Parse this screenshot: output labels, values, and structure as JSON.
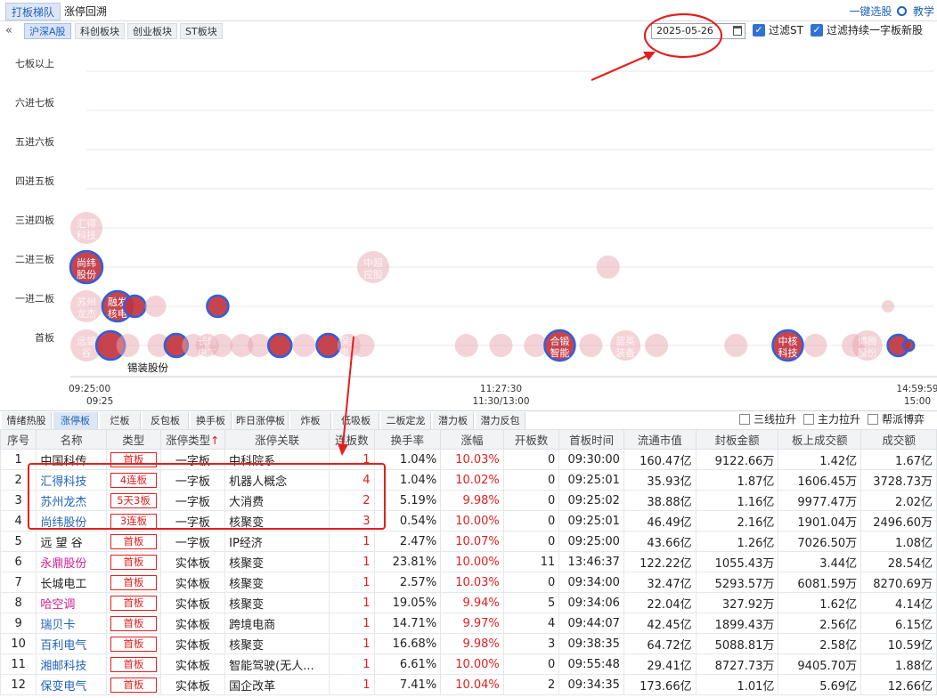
{
  "top_tabs": [
    {
      "label": "打板梯队",
      "active": true
    },
    {
      "label": "涨停回溯",
      "active": false
    }
  ],
  "top_right": {
    "stock_pick": "一键选股",
    "tutorial": "教学"
  },
  "sub_tabs": [
    {
      "label": "沪深A股",
      "active": true
    },
    {
      "label": "科创板块",
      "active": false
    },
    {
      "label": "创业板块",
      "active": false
    },
    {
      "label": "ST板块",
      "active": false
    }
  ],
  "date_value": "2025-05-26",
  "filters": [
    {
      "label": "过滤ST",
      "checked": true
    },
    {
      "label": "过滤持续一字板新股",
      "checked": true
    }
  ],
  "chart_data": {
    "type": "scatter",
    "y_levels": [
      "首板",
      "一进二板",
      "二进三板",
      "三进四板",
      "四进五板",
      "五进六板",
      "六进七板",
      "七板以上"
    ],
    "x_ticks": [
      {
        "time": "09:25:00",
        "sub": "09:25"
      },
      {
        "time": "11:27:30",
        "sub": "11:30/13:00"
      },
      {
        "time": "14:59:59",
        "sub": "15:00"
      }
    ],
    "x_range_minutes": [
      0,
      240
    ],
    "hover_label": "锡装股份",
    "bubbles": [
      {
        "level": 3,
        "t": 0,
        "r": 18,
        "style": "faint",
        "label": "汇得科技"
      },
      {
        "level": 2,
        "t": 0,
        "r": 18,
        "style": "strong",
        "label": "尚纬股份"
      },
      {
        "level": 2,
        "t": 83,
        "r": 18,
        "style": "faint",
        "label": "中超控股"
      },
      {
        "level": 2,
        "t": 151,
        "r": 13,
        "style": "faint",
        "label": ""
      },
      {
        "level": 1,
        "t": 0,
        "r": 18,
        "style": "faint",
        "label": "苏州龙杰"
      },
      {
        "level": 1,
        "t": 9,
        "r": 17,
        "style": "strong",
        "label": "融发核电"
      },
      {
        "level": 1,
        "t": 14,
        "r": 12,
        "style": "strong",
        "label": ""
      },
      {
        "level": 1,
        "t": 20,
        "r": 12,
        "style": "faint",
        "label": ""
      },
      {
        "level": 1,
        "t": 38,
        "r": 12,
        "style": "strong",
        "label": ""
      },
      {
        "level": 1,
        "t": 232,
        "r": 7,
        "style": "faint",
        "label": ""
      },
      {
        "level": 0,
        "t": 0,
        "r": 18,
        "style": "faint",
        "label": "远望谷"
      },
      {
        "level": 0,
        "t": 7,
        "r": 16,
        "style": "strong",
        "label": ""
      },
      {
        "level": 0,
        "t": 12,
        "r": 13,
        "style": "faint",
        "label": ""
      },
      {
        "level": 0,
        "t": 21,
        "r": 13,
        "style": "faint",
        "label": ""
      },
      {
        "level": 0,
        "t": 26,
        "r": 13,
        "style": "strong",
        "label": ""
      },
      {
        "level": 0,
        "t": 31,
        "r": 13,
        "style": "faint",
        "label": ""
      },
      {
        "level": 0,
        "t": 35,
        "r": 13,
        "style": "faint",
        "label": "长城电工"
      },
      {
        "level": 0,
        "t": 39,
        "r": 13,
        "style": "faint",
        "label": ""
      },
      {
        "level": 0,
        "t": 45,
        "r": 13,
        "style": "faint",
        "label": ""
      },
      {
        "level": 0,
        "t": 50,
        "r": 13,
        "style": "faint",
        "label": ""
      },
      {
        "level": 0,
        "t": 56,
        "r": 13,
        "style": "strong",
        "label": ""
      },
      {
        "level": 0,
        "t": 63,
        "r": 13,
        "style": "faint",
        "label": ""
      },
      {
        "level": 0,
        "t": 70,
        "r": 13,
        "style": "strong",
        "label": ""
      },
      {
        "level": 0,
        "t": 76,
        "r": 13,
        "style": "faint",
        "label": "保变电气"
      },
      {
        "level": 0,
        "t": 80,
        "r": 13,
        "style": "faint",
        "label": ""
      },
      {
        "level": 0,
        "t": 110,
        "r": 13,
        "style": "faint",
        "label": ""
      },
      {
        "level": 0,
        "t": 120,
        "r": 13,
        "style": "faint",
        "label": ""
      },
      {
        "level": 0,
        "t": 130,
        "r": 13,
        "style": "faint",
        "label": ""
      },
      {
        "level": 0,
        "t": 137,
        "r": 17,
        "style": "strong",
        "label": "合锻智能"
      },
      {
        "level": 0,
        "t": 146,
        "r": 13,
        "style": "faint",
        "label": ""
      },
      {
        "level": 0,
        "t": 156,
        "r": 17,
        "style": "faint",
        "label": "蓝英装备"
      },
      {
        "level": 0,
        "t": 165,
        "r": 13,
        "style": "faint",
        "label": ""
      },
      {
        "level": 0,
        "t": 188,
        "r": 13,
        "style": "faint",
        "label": ""
      },
      {
        "level": 0,
        "t": 203,
        "r": 17,
        "style": "strong",
        "label": "中核科技"
      },
      {
        "level": 0,
        "t": 211,
        "r": 13,
        "style": "faint",
        "label": ""
      },
      {
        "level": 0,
        "t": 222,
        "r": 13,
        "style": "faint",
        "label": ""
      },
      {
        "level": 0,
        "t": 226,
        "r": 17,
        "style": "faint",
        "label": "博腾股份"
      },
      {
        "level": 0,
        "t": 235,
        "r": 12,
        "style": "strong",
        "label": ""
      },
      {
        "level": 0,
        "t": 238,
        "r": 6,
        "style": "strong",
        "label": ""
      }
    ]
  },
  "bottom_tabs": [
    {
      "label": "情绪热股",
      "active": false
    },
    {
      "label": "涨停板",
      "active": true
    },
    {
      "label": "烂板",
      "active": false
    },
    {
      "label": "反包板",
      "active": false
    },
    {
      "label": "换手板",
      "active": false
    },
    {
      "label": "昨日涨停板",
      "active": false
    },
    {
      "label": "炸板",
      "active": false
    },
    {
      "label": "低吸板",
      "active": false
    },
    {
      "label": "二板定龙",
      "active": false
    },
    {
      "label": "潜力板",
      "active": false
    },
    {
      "label": "潜力反包",
      "active": false
    }
  ],
  "options": [
    {
      "label": "三线拉升"
    },
    {
      "label": "主力拉升"
    },
    {
      "label": "帮派博弈"
    }
  ],
  "table": {
    "columns": [
      "序号",
      "名称",
      "类型",
      "涨停类型",
      "涨停关联",
      "连板数",
      "换手率",
      "涨幅",
      "开板数",
      "首板时间",
      "流通市值",
      "封板金额",
      "板上成交额",
      "成交额"
    ],
    "sort_column": "涨停类型",
    "sort_arrow": "↑",
    "rows": [
      {
        "no": "1",
        "name": "中国科传",
        "name_style": "plain",
        "type": "首板",
        "limit_type": "一字板",
        "rel": "中科院系",
        "streak": "1",
        "turnover": "1.04%",
        "pct": "10.03%",
        "opens": "0",
        "first_time": "09:30:00",
        "float_cap": "160.47亿",
        "seal_amt": "9122.66万",
        "on_board": "1.42亿",
        "amount": "1.67亿"
      },
      {
        "no": "2",
        "name": "汇得科技",
        "name_style": "blue",
        "type": "4连板",
        "limit_type": "一字板",
        "rel": "机器人概念",
        "streak": "4",
        "turnover": "1.04%",
        "pct": "10.02%",
        "opens": "0",
        "first_time": "09:25:01",
        "float_cap": "35.93亿",
        "seal_amt": "1.87亿",
        "on_board": "1606.45万",
        "amount": "3728.73万"
      },
      {
        "no": "3",
        "name": "苏州龙杰",
        "name_style": "blue",
        "type": "5天3板",
        "limit_type": "一字板",
        "rel": "大消费",
        "streak": "2",
        "turnover": "5.19%",
        "pct": "9.98%",
        "opens": "0",
        "first_time": "09:25:02",
        "float_cap": "38.88亿",
        "seal_amt": "1.16亿",
        "on_board": "9977.47万",
        "amount": "2.02亿"
      },
      {
        "no": "4",
        "name": "尚纬股份",
        "name_style": "blue",
        "type": "3连板",
        "limit_type": "一字板",
        "rel": "核聚变",
        "streak": "3",
        "turnover": "0.54%",
        "pct": "10.00%",
        "opens": "0",
        "first_time": "09:25:01",
        "float_cap": "46.49亿",
        "seal_amt": "2.16亿",
        "on_board": "1901.04万",
        "amount": "2496.60万"
      },
      {
        "no": "5",
        "name": "远 望 谷",
        "name_style": "plain",
        "type": "首板",
        "limit_type": "一字板",
        "rel": "IP经济",
        "streak": "1",
        "turnover": "2.47%",
        "pct": "10.07%",
        "opens": "0",
        "first_time": "09:25:00",
        "float_cap": "43.66亿",
        "seal_amt": "1.26亿",
        "on_board": "7026.50万",
        "amount": "1.08亿"
      },
      {
        "no": "6",
        "name": "永鼎股份",
        "name_style": "pink",
        "type": "首板",
        "limit_type": "实体板",
        "rel": "核聚变",
        "streak": "1",
        "turnover": "23.81%",
        "pct": "10.00%",
        "opens": "11",
        "first_time": "13:46:37",
        "float_cap": "122.22亿",
        "seal_amt": "1055.43万",
        "on_board": "3.44亿",
        "amount": "28.54亿"
      },
      {
        "no": "7",
        "name": "长城电工",
        "name_style": "plain",
        "type": "首板",
        "limit_type": "实体板",
        "rel": "核聚变",
        "streak": "1",
        "turnover": "2.57%",
        "pct": "10.03%",
        "opens": "0",
        "first_time": "09:34:00",
        "float_cap": "32.47亿",
        "seal_amt": "5293.57万",
        "on_board": "6081.59万",
        "amount": "8270.69万"
      },
      {
        "no": "8",
        "name": "哈空调",
        "name_style": "pink",
        "type": "首板",
        "limit_type": "实体板",
        "rel": "核聚变",
        "streak": "1",
        "turnover": "19.05%",
        "pct": "9.94%",
        "opens": "5",
        "first_time": "09:34:06",
        "float_cap": "22.04亿",
        "seal_amt": "327.92万",
        "on_board": "1.62亿",
        "amount": "4.14亿"
      },
      {
        "no": "9",
        "name": "瑞贝卡",
        "name_style": "blue",
        "type": "首板",
        "limit_type": "实体板",
        "rel": "跨境电商",
        "streak": "1",
        "turnover": "14.71%",
        "pct": "9.97%",
        "opens": "4",
        "first_time": "09:44:07",
        "float_cap": "42.45亿",
        "seal_amt": "1899.43万",
        "on_board": "2.56亿",
        "amount": "6.15亿"
      },
      {
        "no": "10",
        "name": "百利电气",
        "name_style": "blue",
        "type": "首板",
        "limit_type": "实体板",
        "rel": "核聚变",
        "streak": "1",
        "turnover": "16.68%",
        "pct": "9.98%",
        "opens": "3",
        "first_time": "09:38:35",
        "float_cap": "64.72亿",
        "seal_amt": "5088.81万",
        "on_board": "2.58亿",
        "amount": "10.59亿"
      },
      {
        "no": "11",
        "name": "湘邮科技",
        "name_style": "blue",
        "type": "首板",
        "limit_type": "实体板",
        "rel": "智能驾驶(无人...",
        "streak": "1",
        "turnover": "6.61%",
        "pct": "10.00%",
        "opens": "0",
        "first_time": "09:55:48",
        "float_cap": "29.41亿",
        "seal_amt": "8727.73万",
        "on_board": "9405.70万",
        "amount": "1.88亿"
      },
      {
        "no": "12",
        "name": "保变电气",
        "name_style": "blue",
        "type": "首板",
        "limit_type": "实体板",
        "rel": "国企改革",
        "streak": "1",
        "turnover": "7.41%",
        "pct": "10.04%",
        "opens": "2",
        "first_time": "09:34:35",
        "float_cap": "173.66亿",
        "seal_amt": "1.01亿",
        "on_board": "5.69亿",
        "amount": "12.66亿"
      }
    ]
  }
}
